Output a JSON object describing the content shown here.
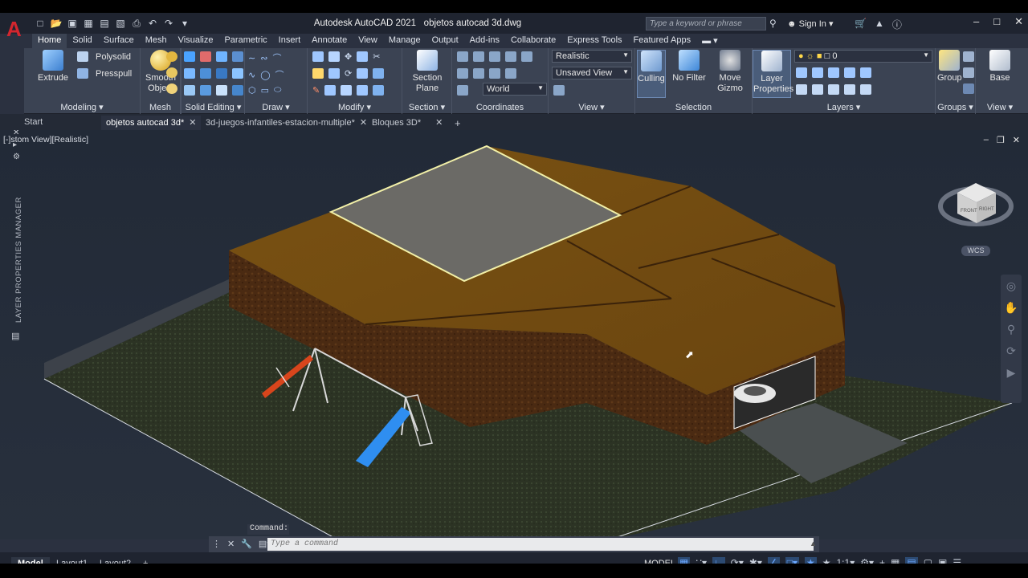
{
  "title_bar": {
    "app_title": "Autodesk AutoCAD 2021",
    "file_name": "objetos autocad 3d.dwg",
    "search_placeholder": "Type a keyword or phrase",
    "sign_in": "Sign In"
  },
  "menu_tabs": [
    "Home",
    "Solid",
    "Surface",
    "Mesh",
    "Visualize",
    "Parametric",
    "Insert",
    "Annotate",
    "View",
    "Manage",
    "Output",
    "Add-ins",
    "Collaborate",
    "Express Tools",
    "Featured Apps"
  ],
  "active_tab": "Home",
  "ribbon": {
    "modeling": {
      "title": "Modeling",
      "extrude": "Extrude",
      "polysolid": "Polysolid",
      "presspull": "Presspull"
    },
    "mesh": {
      "title": "Mesh",
      "smooth_object": "Smooth Object"
    },
    "solid_editing": {
      "title": "Solid Editing"
    },
    "draw": {
      "title": "Draw"
    },
    "modify": {
      "title": "Modify"
    },
    "section": {
      "title": "Section",
      "section_plane": "Section Plane"
    },
    "coordinates": {
      "title": "Coordinates",
      "ucs_value": "World"
    },
    "view": {
      "title": "View",
      "visual_style": "Realistic",
      "named_view": "Unsaved View"
    },
    "selection": {
      "title": "Selection",
      "culling": "Culling",
      "no_filter": "No Filter",
      "move_gizmo": "Move Gizmo"
    },
    "layers": {
      "title": "Layers",
      "layer_properties": "Layer Properties",
      "current_layer": "0"
    },
    "groups": {
      "title": "Groups",
      "group": "Group"
    },
    "view2": {
      "title": "View",
      "base": "Base"
    }
  },
  "file_tabs": [
    {
      "label": "Start",
      "active": false
    },
    {
      "label": "objetos autocad 3d*",
      "active": true
    },
    {
      "label": "3d-juegos-infantiles-estacion-multiple*",
      "active": false
    },
    {
      "label": "Bloques 3D*",
      "active": false
    }
  ],
  "viewport": {
    "label": "[-][Custom View][Realistic]",
    "label_visible": "stom View][Realistic]",
    "side_palette": "LAYER PROPERTIES MANAGER",
    "viewcube_front": "FRONT",
    "viewcube_right": "RIGHT",
    "viewcube_top": "TOP",
    "wcs": "WCS"
  },
  "command": {
    "history_label": "Command:",
    "placeholder": "Type a command"
  },
  "status_bar": {
    "layouts": [
      "Model",
      "Layout1",
      "Layout2"
    ],
    "active_layout": "Model",
    "space": "MODEL",
    "scale": "1:1"
  },
  "colors": {
    "accent": "#6aa7ff",
    "brand": "#d3262e",
    "ribbon_bg": "#3b4353",
    "title_bg": "#1f2430"
  }
}
